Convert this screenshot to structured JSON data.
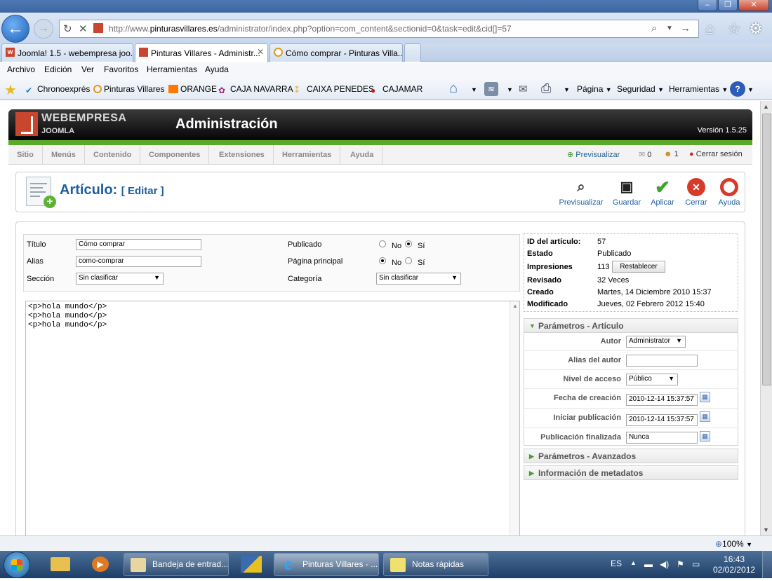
{
  "browser": {
    "url_prefix": "http://www.",
    "url_domain": "pinturasvillares.es",
    "url_path": "/administrator/index.php?option=com_content&sectionid=0&task=edit&cid[]=57",
    "tabs": [
      {
        "label": "Joomla! 1.5 - webempresa joo..."
      },
      {
        "label": "Pinturas Villares - Administr..."
      },
      {
        "label": "Cómo comprar - Pinturas Villa..."
      }
    ],
    "menu": [
      "Archivo",
      "Edición",
      "Ver",
      "Favoritos",
      "Herramientas",
      "Ayuda"
    ],
    "favorites": [
      "Chronoexprés",
      "Pinturas Villares",
      "ORANGE",
      "CAJA NAVARRA",
      "CAIXA PENEDES",
      "CAJAMAR"
    ],
    "commands": [
      "Página",
      "Seguridad",
      "Herramientas"
    ],
    "zoom": "100%"
  },
  "joomla": {
    "brand_line1": "WEBEMPRESA",
    "brand_line2": "JOOMLA",
    "title": "Administración",
    "version": "Versión 1.5.25",
    "menu": [
      "Sitio",
      "Menús",
      "Contenido",
      "Componentes",
      "Extensiones",
      "Herramientas",
      "Ayuda"
    ],
    "status": {
      "preview": "Previsualizar",
      "messages_count": "0",
      "users_count": "1",
      "logout": "Cerrar sesión"
    }
  },
  "toolbar": {
    "title": "Artículo:",
    "subtitle": "[ Editar ]",
    "buttons": {
      "preview": "Previsualizar",
      "save": "Guardar",
      "apply": "Aplicar",
      "close": "Cerrar",
      "help": "Ayuda"
    }
  },
  "form": {
    "title_label": "Título",
    "title_value": "Cómo comprar",
    "alias_label": "Alias",
    "alias_value": "como-comprar",
    "section_label": "Sección",
    "section_value": "Sin clasificar",
    "published_label": "Publicado",
    "frontpage_label": "Página principal",
    "category_label": "Categoría",
    "category_value": "Sin clasificar",
    "no_label": "No",
    "yes_label": "Sí"
  },
  "editor": {
    "content": "<p>hola mundo</p>\n<p>hola mundo</p>\n<p>hola mundo</p>"
  },
  "info": {
    "id_label": "ID del artículo:",
    "id_value": "57",
    "state_label": "Estado",
    "state_value": "Publicado",
    "hits_label": "Impresiones",
    "hits_value": "113",
    "reset_label": "Restablecer",
    "revised_label": "Revisado",
    "revised_value": "32 Veces",
    "created_label": "Creado",
    "created_value": "Martes, 14 Diciembre 2010 15:37",
    "modified_label": "Modificado",
    "modified_value": "Jueves, 02 Febrero 2012 15:40"
  },
  "params": {
    "header": "Parámetros - Artículo",
    "author_label": "Autor",
    "author_value": "Administrator",
    "author_alias_label": "Alias del autor",
    "access_label": "Nivel de acceso",
    "access_value": "Público",
    "created_date_label": "Fecha de creación",
    "created_date_value": "2010-12-14 15:37:57",
    "publish_up_label": "Iniciar publicación",
    "publish_up_value": "2010-12-14 15:37:57",
    "publish_down_label": "Publicación finalizada",
    "publish_down_value": "Nunca",
    "advanced_header": "Parámetros - Avanzados",
    "metadata_header": "Información de metadatos"
  },
  "taskbar": {
    "apps": [
      "Bandeja de entrad...",
      "Pinturas Villares - ...",
      "Notas rápidas"
    ],
    "lang": "ES",
    "time": "16:43",
    "date": "02/02/2012"
  }
}
